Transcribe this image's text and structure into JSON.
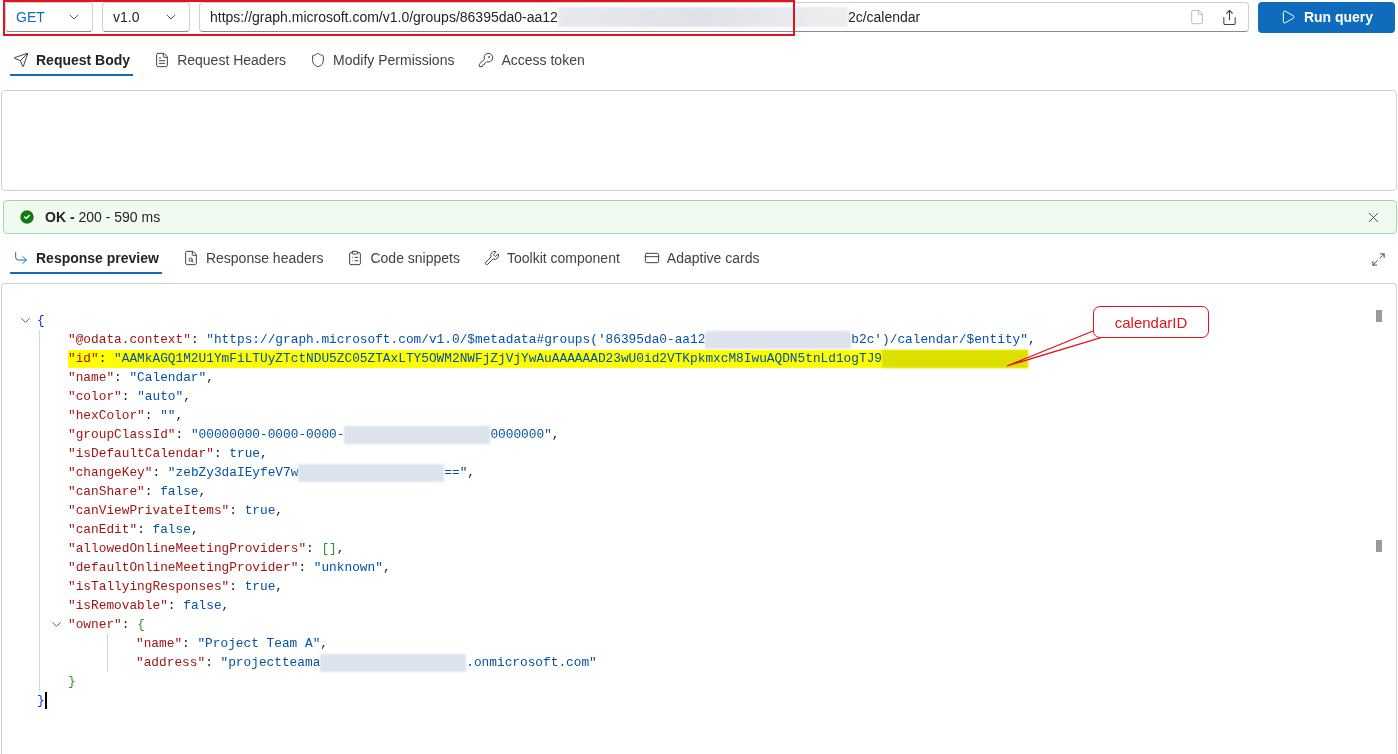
{
  "request": {
    "method": "GET",
    "version": "v1.0",
    "url_parts": [
      "https://graph.microsoft.com/v1.0/groups/86395da0-aa12",
      "2c/calendar"
    ],
    "run_button": "Run query"
  },
  "request_tabs": [
    {
      "label": "Request Body",
      "selected": true
    },
    {
      "label": "Request Headers",
      "selected": false
    },
    {
      "label": "Modify Permissions",
      "selected": false
    },
    {
      "label": "Access token",
      "selected": false
    }
  ],
  "status": {
    "label": "OK -",
    "detail": "200 - 590 ms"
  },
  "response_tabs": [
    {
      "label": "Response preview",
      "selected": true
    },
    {
      "label": "Response headers",
      "selected": false
    },
    {
      "label": "Code snippets",
      "selected": false
    },
    {
      "label": "Toolkit component",
      "selected": false
    },
    {
      "label": "Adaptive cards",
      "selected": false
    }
  ],
  "annotation": {
    "text": "calendarID"
  },
  "response_lines": [
    {
      "highlighted": false,
      "collapsible": true,
      "tokens": [
        {
          "kind": "brace",
          "text": "{"
        }
      ],
      "children": [
        {
          "highlighted": false,
          "tokens": [
            {
              "kind": "key",
              "text": "\"@odata.context\""
            },
            {
              "kind": "punct",
              "text": ": "
            },
            {
              "kind": "string",
              "text": "\"https://graph.microsoft.com/v1.0/$metadata#groups('86395da0-aa12"
            },
            {
              "kind": "redacted"
            },
            {
              "kind": "string",
              "text": "b2c')/calendar/$entity\""
            },
            {
              "kind": "punct",
              "text": ","
            }
          ]
        },
        {
          "highlighted": true,
          "tokens": [
            {
              "kind": "key",
              "text": "\"id\""
            },
            {
              "kind": "punct",
              "text": ": "
            },
            {
              "kind": "string",
              "text": "\"AAMkAGQ1M2U1YmFiLTUyZTctNDU5ZC05ZTAxLTY5OWM2NWFjZjVjYwAuAAAAAAD23wU0id2VTKpkmxcM8IwuAQDN5tnLd1ogTJ9"
            },
            {
              "kind": "redacted"
            }
          ]
        },
        {
          "highlighted": false,
          "tokens": [
            {
              "kind": "key",
              "text": "\"name\""
            },
            {
              "kind": "punct",
              "text": ": "
            },
            {
              "kind": "string",
              "text": "\"Calendar\""
            },
            {
              "kind": "punct",
              "text": ","
            }
          ]
        },
        {
          "highlighted": false,
          "tokens": [
            {
              "kind": "key",
              "text": "\"color\""
            },
            {
              "kind": "punct",
              "text": ": "
            },
            {
              "kind": "string",
              "text": "\"auto\""
            },
            {
              "kind": "punct",
              "text": ","
            }
          ]
        },
        {
          "highlighted": false,
          "tokens": [
            {
              "kind": "key",
              "text": "\"hexColor\""
            },
            {
              "kind": "punct",
              "text": ": "
            },
            {
              "kind": "string",
              "text": "\"\""
            },
            {
              "kind": "punct",
              "text": ","
            }
          ]
        },
        {
          "highlighted": false,
          "tokens": [
            {
              "kind": "key",
              "text": "\"groupClassId\""
            },
            {
              "kind": "punct",
              "text": ": "
            },
            {
              "kind": "string",
              "text": "\"00000000-0000-0000-"
            },
            {
              "kind": "redacted"
            },
            {
              "kind": "string",
              "text": "0000000\""
            },
            {
              "kind": "punct",
              "text": ","
            }
          ]
        },
        {
          "highlighted": false,
          "tokens": [
            {
              "kind": "key",
              "text": "\"isDefaultCalendar\""
            },
            {
              "kind": "punct",
              "text": ": "
            },
            {
              "kind": "literal",
              "text": "true"
            },
            {
              "kind": "punct",
              "text": ","
            }
          ]
        },
        {
          "highlighted": false,
          "tokens": [
            {
              "kind": "key",
              "text": "\"changeKey\""
            },
            {
              "kind": "punct",
              "text": ": "
            },
            {
              "kind": "string",
              "text": "\"zebZy3daIEyfeV7w"
            },
            {
              "kind": "redacted"
            },
            {
              "kind": "string",
              "text": "==\""
            },
            {
              "kind": "punct",
              "text": ","
            }
          ]
        },
        {
          "highlighted": false,
          "tokens": [
            {
              "kind": "key",
              "text": "\"canShare\""
            },
            {
              "kind": "punct",
              "text": ": "
            },
            {
              "kind": "literal",
              "text": "false"
            },
            {
              "kind": "punct",
              "text": ","
            }
          ]
        },
        {
          "highlighted": false,
          "tokens": [
            {
              "kind": "key",
              "text": "\"canViewPrivateItems\""
            },
            {
              "kind": "punct",
              "text": ": "
            },
            {
              "kind": "literal",
              "text": "true"
            },
            {
              "kind": "punct",
              "text": ","
            }
          ]
        },
        {
          "highlighted": false,
          "tokens": [
            {
              "kind": "key",
              "text": "\"canEdit\""
            },
            {
              "kind": "punct",
              "text": ": "
            },
            {
              "kind": "literal",
              "text": "false"
            },
            {
              "kind": "punct",
              "text": ","
            }
          ]
        },
        {
          "highlighted": false,
          "tokens": [
            {
              "kind": "key",
              "text": "\"allowedOnlineMeetingProviders\""
            },
            {
              "kind": "punct",
              "text": ": "
            },
            {
              "kind": "bracket",
              "text": "[]"
            },
            {
              "kind": "punct",
              "text": ","
            }
          ]
        },
        {
          "highlighted": false,
          "tokens": [
            {
              "kind": "key",
              "text": "\"defaultOnlineMeetingProvider\""
            },
            {
              "kind": "punct",
              "text": ": "
            },
            {
              "kind": "string",
              "text": "\"unknown\""
            },
            {
              "kind": "punct",
              "text": ","
            }
          ]
        },
        {
          "highlighted": false,
          "tokens": [
            {
              "kind": "key",
              "text": "\"isTallyingResponses\""
            },
            {
              "kind": "punct",
              "text": ": "
            },
            {
              "kind": "literal",
              "text": "true"
            },
            {
              "kind": "punct",
              "text": ","
            }
          ]
        },
        {
          "highlighted": false,
          "tokens": [
            {
              "kind": "key",
              "text": "\"isRemovable\""
            },
            {
              "kind": "punct",
              "text": ": "
            },
            {
              "kind": "literal",
              "text": "false"
            },
            {
              "kind": "punct",
              "text": ","
            }
          ]
        },
        {
          "highlighted": false,
          "collapsible": true,
          "tokens": [
            {
              "kind": "key",
              "text": "\"owner\""
            },
            {
              "kind": "punct",
              "text": ": "
            },
            {
              "kind": "bracket",
              "text": "{"
            }
          ],
          "children": [
            {
              "highlighted": false,
              "tokens": [
                {
                  "kind": "key",
                  "text": "\"name\""
                },
                {
                  "kind": "punct",
                  "text": ": "
                },
                {
                  "kind": "string",
                  "text": "\"Project Team A\""
                },
                {
                  "kind": "punct",
                  "text": ","
                }
              ]
            },
            {
              "highlighted": false,
              "tokens": [
                {
                  "kind": "key",
                  "text": "\"address\""
                },
                {
                  "kind": "punct",
                  "text": ": "
                },
                {
                  "kind": "string",
                  "text": "\"projectteama"
                },
                {
                  "kind": "redacted"
                },
                {
                  "kind": "string",
                  "text": ".onmicrosoft.com\""
                }
              ]
            }
          ],
          "closing": [
            {
              "kind": "bracket",
              "text": "}"
            }
          ]
        }
      ],
      "closing": [
        {
          "kind": "brace",
          "text": "}"
        }
      ]
    }
  ]
}
